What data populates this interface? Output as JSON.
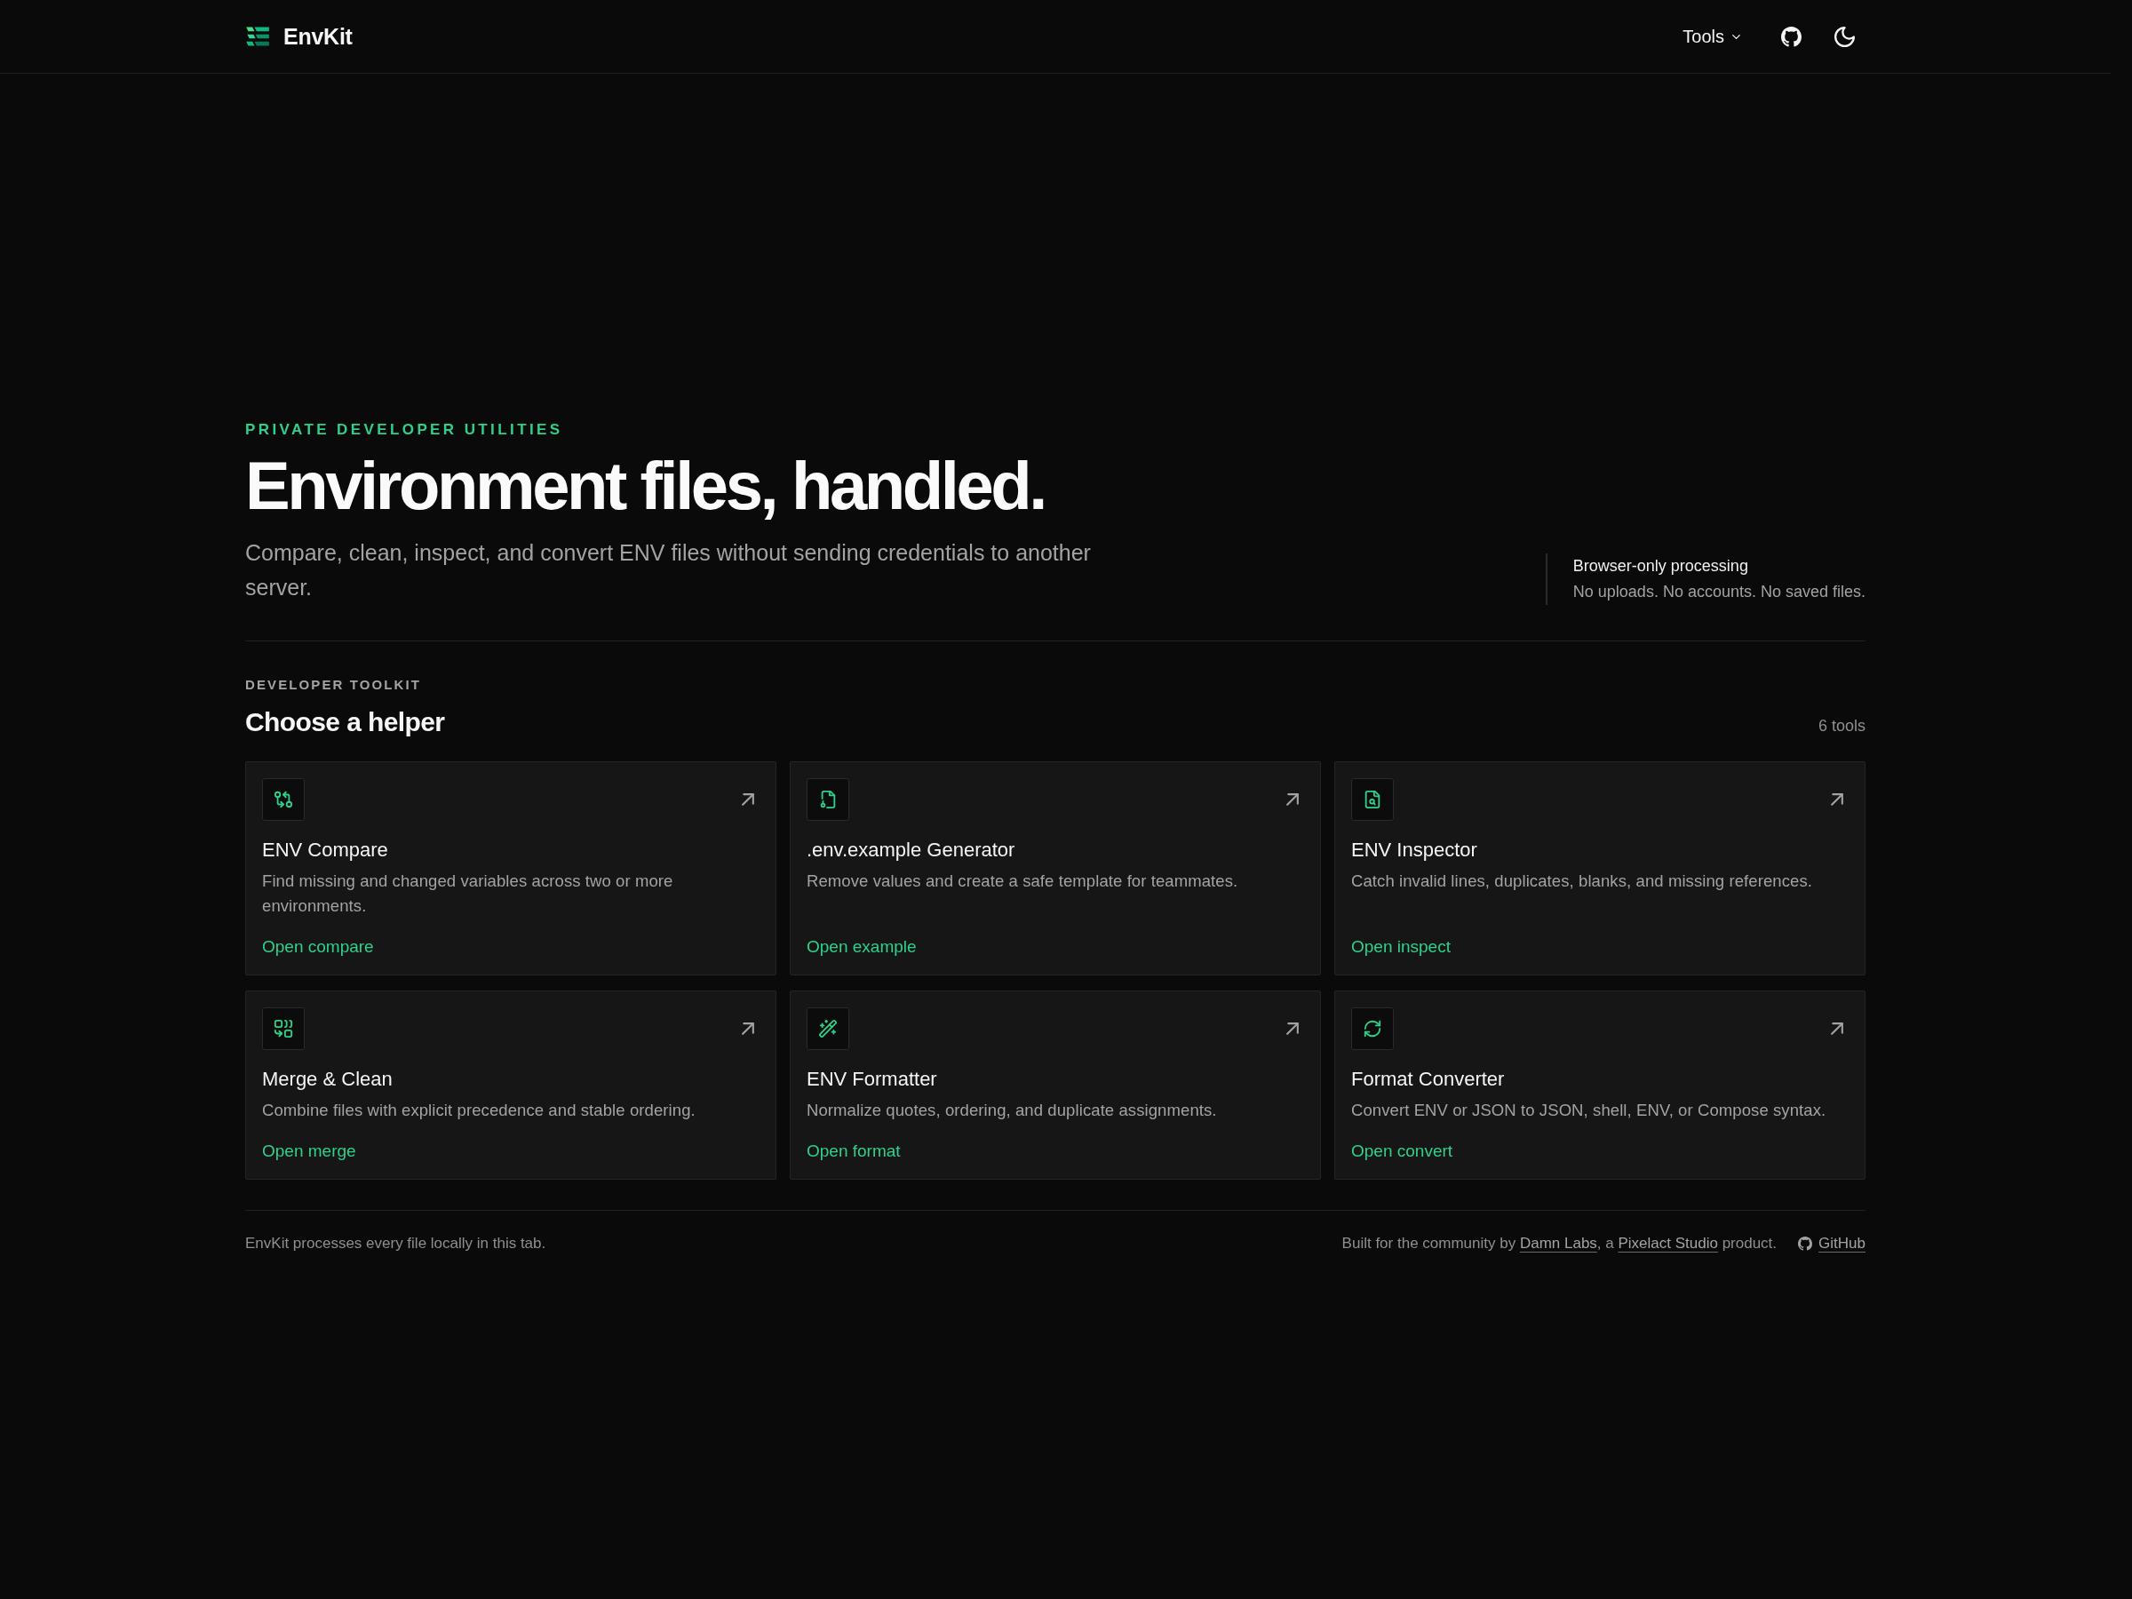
{
  "header": {
    "brand": "EnvKit",
    "menu": "Tools"
  },
  "hero": {
    "eyebrow": "PRIVATE DEVELOPER UTILITIES",
    "title": "Environment files, handled.",
    "subtitle": "Compare, clean, inspect, and convert ENV files without sending credentials to another server.",
    "note": {
      "title": "Browser-only processing",
      "text": "No uploads. No accounts. No saved files."
    }
  },
  "toolkit": {
    "eyebrow": "DEVELOPER TOOLKIT",
    "title": "Choose a helper",
    "count": "6 tools",
    "tools": [
      {
        "kind": "compare",
        "name": "ENV Compare",
        "description": "Find missing and changed variables across two or more environments.",
        "link": "Open compare"
      },
      {
        "kind": "template",
        "name": ".env.example Generator",
        "description": "Remove values and create a safe template for teammates.",
        "link": "Open example"
      },
      {
        "kind": "inspect",
        "name": "ENV Inspector",
        "description": "Catch invalid lines, duplicates, blanks, and missing references.",
        "link": "Open inspect"
      },
      {
        "kind": "merge",
        "name": "Merge & Clean",
        "description": "Combine files with explicit precedence and stable ordering.",
        "link": "Open merge"
      },
      {
        "kind": "format",
        "name": "ENV Formatter",
        "description": "Normalize quotes, ordering, and duplicate assignments.",
        "link": "Open format"
      },
      {
        "kind": "convert",
        "name": "Format Converter",
        "description": "Convert ENV or JSON to JSON, shell, ENV, or Compose syntax.",
        "link": "Open convert"
      }
    ]
  },
  "footer": {
    "note": "EnvKit processes every file locally in this tab.",
    "credit": [
      {
        "kind": "text",
        "text": "Built for the community by "
      },
      {
        "kind": "link",
        "text": "Damn Labs"
      },
      {
        "kind": "text",
        "text": ", a "
      },
      {
        "kind": "link",
        "text": "Pixelact Studio"
      },
      {
        "kind": "text",
        "text": " product."
      }
    ],
    "github": "GitHub"
  }
}
